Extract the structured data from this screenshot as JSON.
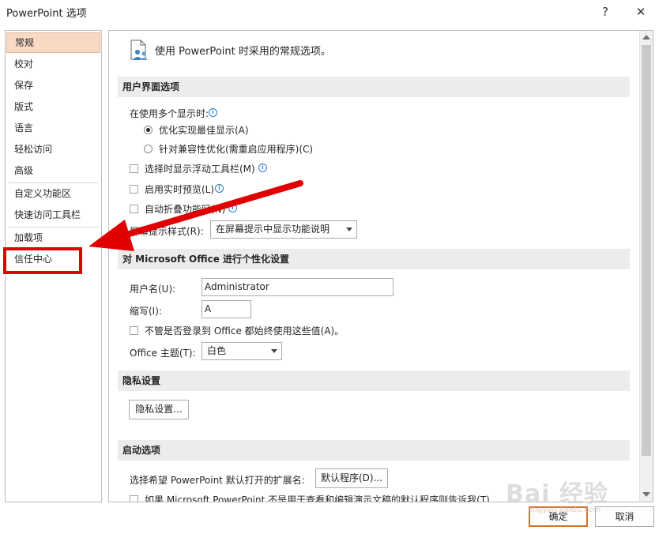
{
  "window": {
    "title": "PowerPoint 选项",
    "help_glyph": "?",
    "close_glyph": "✕"
  },
  "sidebar": {
    "items": [
      {
        "label": "常规"
      },
      {
        "label": "校对"
      },
      {
        "label": "保存"
      },
      {
        "label": "版式"
      },
      {
        "label": "语言"
      },
      {
        "label": "轻松访问"
      },
      {
        "label": "高级"
      },
      {
        "label": "自定义功能区"
      },
      {
        "label": "快速访问工具栏"
      },
      {
        "label": "加载项"
      },
      {
        "label": "信任中心"
      }
    ],
    "selected_index": 0
  },
  "main": {
    "intro": "使用 PowerPoint 时采用的常规选项。",
    "ui_options": {
      "header": "用户界面选项",
      "multi_display_label": "在使用多个显示时:",
      "radio_best": "优化实现最佳显示(A)",
      "radio_compat": "针对兼容性优化(需重启应用程序)(C)",
      "check_mini_toolbar": "选择时显示浮动工具栏(M)",
      "check_live_preview": "启用实时预览(L)",
      "check_collapse_ribbon": "自动折叠功能区(N)",
      "screentip_label": "屏幕提示样式(R):",
      "screentip_value": "在屏幕提示中显示功能说明"
    },
    "personalize": {
      "header": "对 Microsoft Office 进行个性化设置",
      "username_label": "用户名(U):",
      "username_value": "Administrator",
      "initials_label": "缩写(I):",
      "initials_value": "A",
      "always_use_label": "不管是否登录到 Office 都始终使用这些值(A)。",
      "theme_label": "Office 主题(T):",
      "theme_value": "白色"
    },
    "privacy": {
      "header": "隐私设置",
      "button": "隐私设置..."
    },
    "startup": {
      "header": "启动选项",
      "ext_label": "选择希望 PowerPoint 默认打开的扩展名:",
      "default_programs_button": "默认程序(D)...",
      "check_tell_me": "如果 Microsoft PowerPoint 不是用于查看和编辑演示文稿的默认程序则告诉我(T)"
    }
  },
  "footer": {
    "ok": "确定",
    "cancel": "取消"
  },
  "watermark": {
    "brand": "Bai 经验",
    "url": "jingyan.baidu.com"
  },
  "colors": {
    "selected_bg": "#f8d9c4",
    "annotation_red": "#e00000",
    "primary_border": "#d2722f"
  }
}
